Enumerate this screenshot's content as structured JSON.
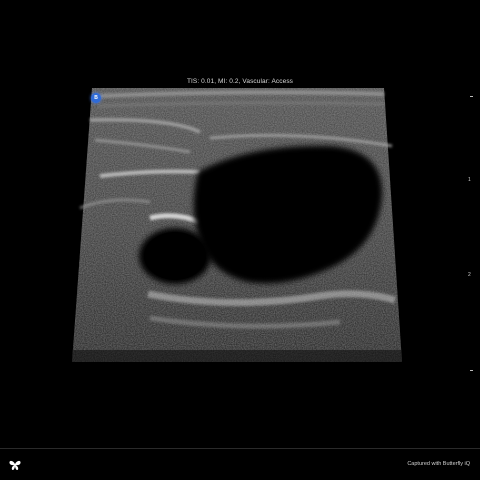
{
  "header": {
    "settings_text": "TIS: 0.01, MI: 0.2, Vascular: Access"
  },
  "orientation_marker": {
    "label": "B",
    "color": "#2f6bd8"
  },
  "depth_scale": {
    "labels": [
      "1",
      "2"
    ]
  },
  "footer": {
    "caption": "Captured with Butterfly iQ",
    "logo_icon": "butterfly-icon"
  }
}
